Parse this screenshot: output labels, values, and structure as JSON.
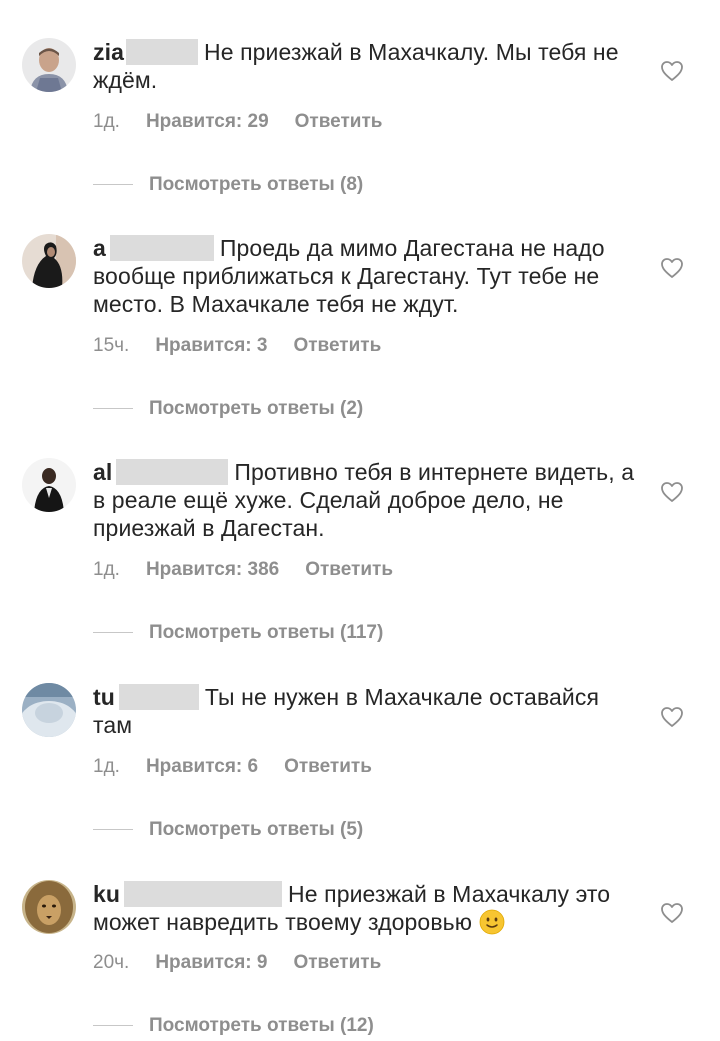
{
  "comments": [
    {
      "username_prefix": "zia",
      "text": "Не приезжай в Махачкалу. Мы тебя не ждём.",
      "time": "1д.",
      "likes": "Нравится: 29",
      "reply": "Ответить",
      "view_replies": "Посмотреть ответы (8)"
    },
    {
      "username_prefix": "a",
      "text": "Проедь да мимо Дагестана не надо вообще приближаться к Дагестану. Тут тебе не место. В Махачкале тебя не ждут.",
      "time": "15ч.",
      "likes": "Нравится: 3",
      "reply": "Ответить",
      "view_replies": "Посмотреть ответы (2)"
    },
    {
      "username_prefix": "al",
      "text": "Противно тебя в интернете видеть, а в реале ещё хуже. Сделай доброе дело, не приезжай в Дагестан.",
      "time": "1д.",
      "likes": "Нравится: 386",
      "reply": "Ответить",
      "view_replies": "Посмотреть ответы (117)"
    },
    {
      "username_prefix": "tu",
      "text": "Ты не нужен в Махачкале оставайся там",
      "time": "1д.",
      "likes": "Нравится: 6",
      "reply": "Ответить",
      "view_replies": "Посмотреть ответы (5)"
    },
    {
      "username_prefix": "ku",
      "text": "Не приезжай в Махачкалу это может навредить твоему здоровью",
      "emoji": "slightly-smiling-face",
      "time": "20ч.",
      "likes": "Нравится: 9",
      "reply": "Ответить",
      "view_replies": "Посмотреть ответы (12)"
    }
  ],
  "icons": {
    "like": "heart-outline-icon",
    "avatar": "user-avatar"
  },
  "colors": {
    "text": "#262626",
    "secondary": "#8e8e8e",
    "redaction": "#dcdcdc"
  }
}
